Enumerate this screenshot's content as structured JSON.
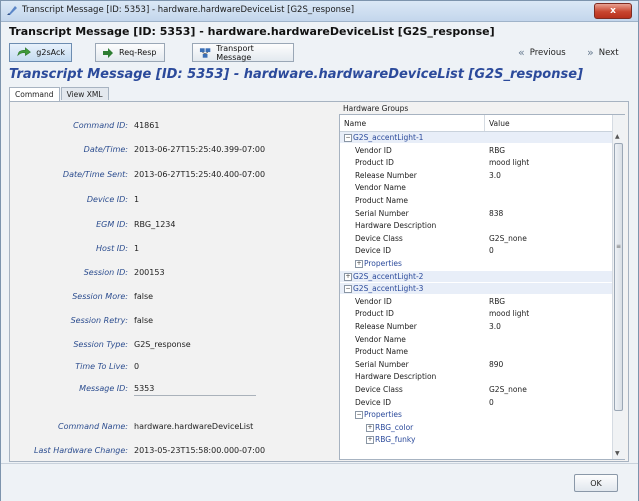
{
  "window": {
    "title": "Transcript Message [ID: 5353] - hardware.hardwareDeviceList [G2S_response]",
    "close_label": "x",
    "header_title": "Transcript Message [ID: 5353] - hardware.hardwareDeviceList [G2S_response]",
    "big_title": "Transcript Message [ID: 5353] - hardware.hardwareDeviceList [G2S_response]"
  },
  "toolbar": {
    "buttons": [
      {
        "label": "g2sAck",
        "icon": "ack-arrow-icon"
      },
      {
        "label": "Req-Resp",
        "icon": "right-arrow-icon"
      },
      {
        "label": "Transport Message",
        "icon": "network-icon"
      }
    ],
    "previous_label": "Previous",
    "next_label": "Next"
  },
  "tabs": [
    "Command",
    "View XML"
  ],
  "fields": [
    {
      "label": "Command ID:",
      "value": "41861"
    },
    {
      "label": "Date/Time:",
      "value": "2013-06-27T15:25:40.399-07:00"
    },
    {
      "label": "Date/Time Sent:",
      "value": "2013-06-27T15:25:40.400-07:00"
    },
    {
      "label": "Device ID:",
      "value": "1"
    },
    {
      "label": "EGM ID:",
      "value": "RBG_1234"
    },
    {
      "label": "Host ID:",
      "value": "1"
    },
    {
      "label": "Session ID:",
      "value": "200153"
    },
    {
      "label": "Session More:",
      "value": "false"
    },
    {
      "label": "Session Retry:",
      "value": "false"
    },
    {
      "label": "Session Type:",
      "value": "G2S_response"
    },
    {
      "label": "Time To Live:",
      "value": "0"
    },
    {
      "label": "Message ID:",
      "value": "5353"
    },
    {
      "label": "Command Name:",
      "value": "hardware.hardwareDeviceList"
    },
    {
      "label": "Last Hardware Change:",
      "value": "2013-05-23T15:58:00.000-07:00"
    }
  ],
  "hardware_groups": {
    "title": "Hardware Groups",
    "col_name": "Name",
    "col_value": "Value",
    "rows": [
      {
        "name": "G2S_accentLight-1",
        "value": "",
        "level": 0,
        "kind": "group",
        "exp": "−"
      },
      {
        "name": "Vendor ID",
        "value": "RBG",
        "level": 1,
        "kind": "leaf"
      },
      {
        "name": "Product ID",
        "value": "mood light",
        "level": 1,
        "kind": "leaf"
      },
      {
        "name": "Release Number",
        "value": "3.0",
        "level": 1,
        "kind": "leaf"
      },
      {
        "name": "Vendor Name",
        "value": "",
        "level": 1,
        "kind": "leaf"
      },
      {
        "name": "Product Name",
        "value": "",
        "level": 1,
        "kind": "leaf"
      },
      {
        "name": "Serial Number",
        "value": "838",
        "level": 1,
        "kind": "leaf"
      },
      {
        "name": "Hardware Description",
        "value": "",
        "level": 1,
        "kind": "leaf"
      },
      {
        "name": "Device Class",
        "value": "G2S_none",
        "level": 1,
        "kind": "leaf"
      },
      {
        "name": "Device ID",
        "value": "0",
        "level": 1,
        "kind": "leaf"
      },
      {
        "name": "Properties",
        "value": "",
        "level": 1,
        "kind": "link",
        "exp": "+"
      },
      {
        "name": "G2S_accentLight-2",
        "value": "",
        "level": 0,
        "kind": "collapsed",
        "exp": "+"
      },
      {
        "name": "G2S_accentLight-3",
        "value": "",
        "level": 0,
        "kind": "group",
        "exp": "−"
      },
      {
        "name": "Vendor ID",
        "value": "RBG",
        "level": 1,
        "kind": "leaf"
      },
      {
        "name": "Product ID",
        "value": "mood light",
        "level": 1,
        "kind": "leaf"
      },
      {
        "name": "Release Number",
        "value": "3.0",
        "level": 1,
        "kind": "leaf"
      },
      {
        "name": "Vendor Name",
        "value": "",
        "level": 1,
        "kind": "leaf"
      },
      {
        "name": "Product Name",
        "value": "",
        "level": 1,
        "kind": "leaf"
      },
      {
        "name": "Serial Number",
        "value": "890",
        "level": 1,
        "kind": "leaf"
      },
      {
        "name": "Hardware Description",
        "value": "",
        "level": 1,
        "kind": "leaf"
      },
      {
        "name": "Device Class",
        "value": "G2S_none",
        "level": 1,
        "kind": "leaf"
      },
      {
        "name": "Device ID",
        "value": "0",
        "level": 1,
        "kind": "leaf"
      },
      {
        "name": "Properties",
        "value": "",
        "level": 1,
        "kind": "link",
        "exp": "−"
      },
      {
        "name": "RBG_color",
        "value": "",
        "level": 2,
        "kind": "link",
        "exp": "+"
      },
      {
        "name": "RBG_funky",
        "value": "",
        "level": 2,
        "kind": "link",
        "exp": "+"
      }
    ]
  },
  "footer": {
    "ok_label": "OK"
  }
}
